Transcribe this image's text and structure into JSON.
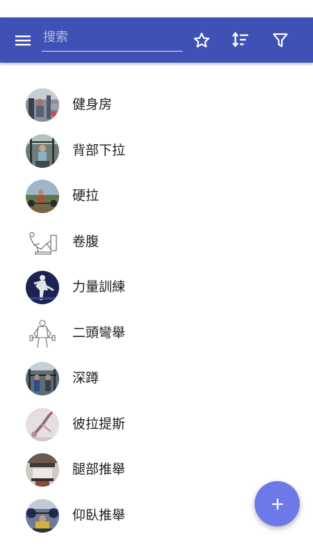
{
  "app_bar": {
    "color": "#3f51b5",
    "menu_icon": "menu-icon",
    "search": {
      "placeholder": "搜索",
      "value": ""
    },
    "favorite_icon": "star-outline-icon",
    "sort_icon": "sort-icon",
    "filter_icon": "filter-icon"
  },
  "exercises": [
    {
      "label": "健身房",
      "icon": "gym-photo"
    },
    {
      "label": "背部下拉",
      "icon": "lat-pulldown-photo"
    },
    {
      "label": "硬拉",
      "icon": "deadlift-photo"
    },
    {
      "label": "卷腹",
      "icon": "crunch-line-drawing"
    },
    {
      "label": "力量訓練",
      "icon": "strength-training-photo"
    },
    {
      "label": "二頭彎舉",
      "icon": "bicep-curl-line-drawing"
    },
    {
      "label": "深蹲",
      "icon": "squat-photo"
    },
    {
      "label": "彼拉提斯",
      "icon": "pilates-photo"
    },
    {
      "label": "腿部推舉",
      "icon": "leg-press-photo"
    },
    {
      "label": "仰臥推舉",
      "icon": "bench-press-photo"
    }
  ],
  "fab": {
    "icon": "plus-icon",
    "color": "#6d79e8"
  }
}
